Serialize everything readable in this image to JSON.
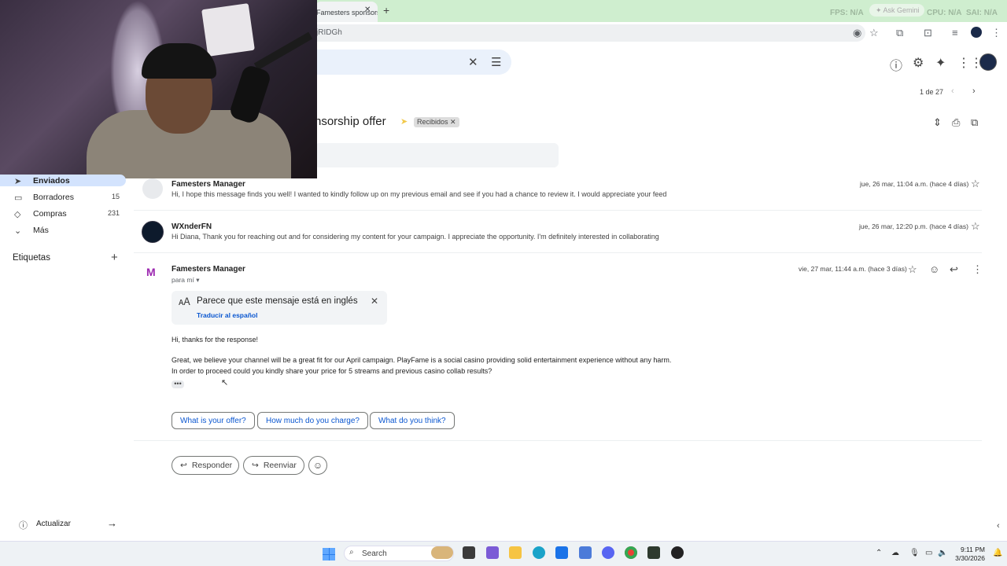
{
  "browser": {
    "tab_title": "Famesters sponsorship offer",
    "address_fragment": "jRIDGh",
    "overlay_fps": "FPS: N/A",
    "overlay_cpu": "CPU: N/A",
    "overlay_sai": "SAI: N/A",
    "ask_gemini": "Ask Gemini"
  },
  "header": {
    "help_icon": "help-icon",
    "settings_icon": "gear-icon",
    "gemini_icon": "sparkle-icon",
    "apps_icon": "apps-grid-icon"
  },
  "pager": {
    "text": "1 de 27"
  },
  "thread": {
    "subject": "Famesters sponsorship offer",
    "subject_visible": "nsorship offer",
    "label": "Recibidos"
  },
  "sidebar": {
    "items": [
      {
        "label": "Enviados",
        "count": ""
      },
      {
        "label": "Borradores",
        "count": "15"
      },
      {
        "label": "Compras",
        "count": "231"
      },
      {
        "label": "Más",
        "count": ""
      }
    ],
    "labels_heading": "Etiquetas",
    "update_label": "Actualizar"
  },
  "messages": [
    {
      "sender": "Famesters Manager",
      "snippet": "Hi, I hope this message finds you well! I wanted to kindly follow up on my previous email and see if you had a chance to review it. I would appreciate your feed",
      "date": "jue, 26 mar, 11:04 a.m. (hace 4 días)"
    },
    {
      "sender": "WXnderFN",
      "snippet": "Hi Diana, Thank you for reaching out and for considering my content for your campaign. I appreciate the opportunity. I'm definitely interested in collaborating",
      "date": "jue, 26 mar, 12:20 p.m. (hace 4 días)"
    },
    {
      "sender": "Famesters Manager",
      "recipient": "para mí",
      "date": "vie, 27 mar, 11:44 a.m. (hace 3 días)"
    }
  ],
  "translate": {
    "title": "Parece que este mensaje está en inglés",
    "link": "Traducir al español"
  },
  "body": {
    "greeting": "Hi, thanks for the response!",
    "line1": "Great, we believe your channel will be a great fit for our April campaign. PlayFame is a social casino providing solid entertainment experience without any harm.",
    "line2": "In order to proceed could you kindly share your price for 5 streams and previous casino collab results?",
    "ellipsis": "•••"
  },
  "smart_replies": [
    "What is your offer?",
    "How much do you charge?",
    "What do you think?"
  ],
  "actions": {
    "reply": "Responder",
    "forward": "Reenviar"
  },
  "taskbar": {
    "search": "Search",
    "time": "9:11 PM",
    "date": "3/30/2026"
  }
}
